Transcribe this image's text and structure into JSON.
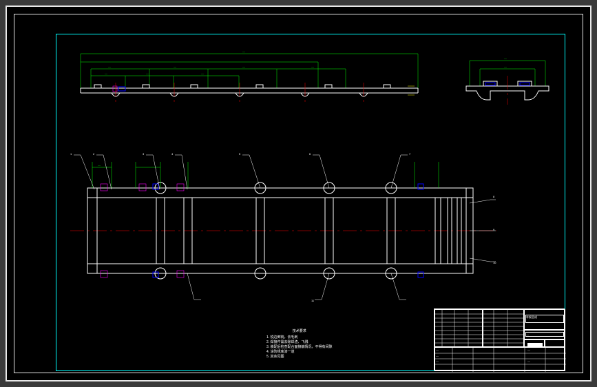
{
  "drawing": {
    "type": "CAD mechanical drawing",
    "background": "#000000",
    "frame_color": "#e8e8e8",
    "border_color": "#00ffff",
    "part_color": "#ffffff",
    "dimension_color": "#00ff00",
    "centerline_color": "#ff0000"
  },
  "views": {
    "top_main": {
      "description": "Long side elevation with dimension stack",
      "position": "upper-left",
      "dimension_count": 10
    },
    "top_right": {
      "description": "End elevation view",
      "position": "upper-right"
    },
    "plan": {
      "description": "Plan view of frame with cross members and balloon leaders",
      "position": "center",
      "balloon_count": 11
    }
  },
  "dimensions": {
    "overall": "—",
    "d1": "—",
    "d2": "—",
    "d3": "—",
    "d4": "—",
    "d5": "—",
    "s1": "—",
    "s2": "—",
    "s3": "—",
    "s4": "—",
    "s5": "—"
  },
  "notes": {
    "title": "技术要求",
    "line1": "1. 锐边倒钝，去毛刺",
    "line2": "2. 焊接件需去除焊渣、飞溅",
    "line3": "3. 装配后检查配合面接触情况，不得有间隙",
    "line4": "4. 涂防锈底漆一道",
    "line5": "5. 其余见图"
  },
  "title_block": {
    "drawing_name": "车架总成",
    "drawing_no": "—",
    "scale": "—",
    "sheet": "—",
    "material": "—",
    "designed": "—",
    "checked": "—",
    "approved": "—",
    "date": "—",
    "company": "—"
  },
  "balloons": {
    "b1": "1",
    "b2": "2",
    "b3": "3",
    "b4": "4",
    "b5": "5",
    "b6": "6",
    "b7": "7",
    "b8": "8",
    "b9": "9",
    "b10": "10",
    "b11": "11"
  }
}
